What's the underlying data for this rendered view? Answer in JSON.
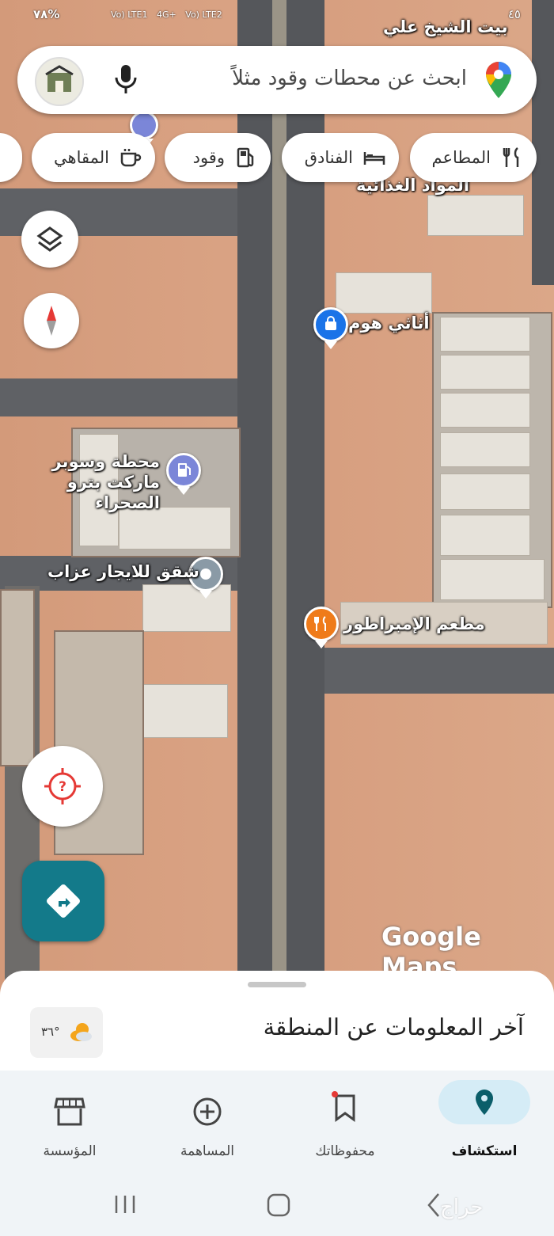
{
  "status": {
    "battery": "٧٨%",
    "network": "4G+",
    "volte1": "Vo) LTE1",
    "volte2": "Vo) LTE2",
    "time": "٤٥"
  },
  "search": {
    "placeholder": "ابحث عن محطات وقود مثلاً"
  },
  "chips": [
    {
      "label": "المطاعم",
      "icon": "fork-knife-icon"
    },
    {
      "label": "الفنادق",
      "icon": "bed-icon"
    },
    {
      "label": "وقود",
      "icon": "gas-pump-icon"
    },
    {
      "label": "المقاهي",
      "icon": "coffee-cup-icon"
    }
  ],
  "map": {
    "places": [
      {
        "name": "بيت الشيخ علي"
      },
      {
        "name": "المواد الغذائية"
      },
      {
        "name": "أثاثي هوم",
        "icon": "shopping-bag-icon",
        "color": "#1a73e8"
      },
      {
        "name": "محطة وسوبر ماركت بترو الصحراء",
        "icon": "gas-pump-icon",
        "color": "#7b86d8"
      },
      {
        "name": "شقق للايجار عزاب",
        "icon": "pin-icon",
        "color": "#8a9aa6"
      },
      {
        "name": "مطعم الإمبراطور",
        "icon": "fork-knife-icon",
        "color": "#ef7b1a"
      }
    ],
    "watermark": "Google Maps"
  },
  "sheet": {
    "title": "آخر المعلومات عن المنطقة",
    "temperature": "٣٦°"
  },
  "nav": [
    {
      "label": "استكشاف",
      "icon": "location-pin-icon",
      "active": true
    },
    {
      "label": "محفوظاتك",
      "icon": "bookmark-icon",
      "active": false
    },
    {
      "label": "المساهمة",
      "icon": "plus-circle-icon",
      "active": false
    },
    {
      "label": "المؤسسة",
      "icon": "storefront-icon",
      "active": false
    }
  ],
  "watermark_site": "حراج",
  "colors": {
    "accent": "#1a6f7a",
    "directions": "#137a8a",
    "active_nav": "#d5ecf6"
  }
}
